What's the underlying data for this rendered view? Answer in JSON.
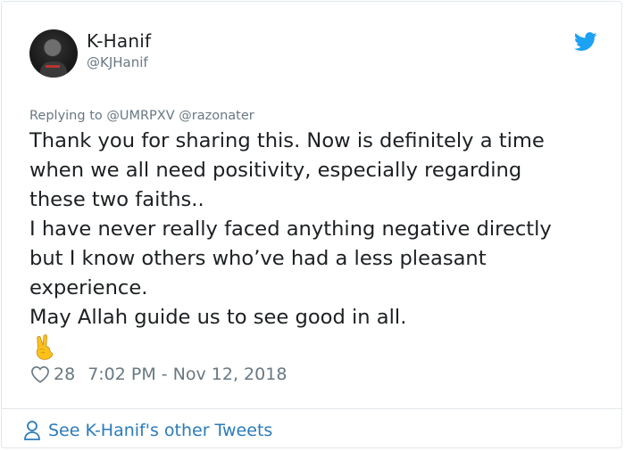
{
  "author": {
    "display_name": "K-Hanif",
    "handle": "@KJHanif"
  },
  "tweet": {
    "reply_prefix": "Replying to",
    "reply_targets": "@UMRPXV @razonater",
    "lines": [
      "Thank you for sharing this. Now is definitely a time",
      "when we all need positivity, especially regarding",
      "these two faiths..",
      "I have never really faced anything negative directly",
      "but I know others who’ve had a less pleasant",
      "experience.",
      "May Allah guide us to see good in all."
    ],
    "emoji": "victory-hand-emoji",
    "likes": "28",
    "timestamp": "7:02 PM - Nov 12, 2018"
  },
  "footer": {
    "more_tweets_label": "See K-Hanif's other Tweets"
  },
  "colors": {
    "text": "#1c2022",
    "muted": "#697882",
    "link": "#2b7bb9",
    "twitter_blue": "#1da1f2",
    "border": "#e1e8ed"
  },
  "icons": {
    "brand": "twitter-bird-icon",
    "like": "heart-icon",
    "profile": "person-icon"
  }
}
